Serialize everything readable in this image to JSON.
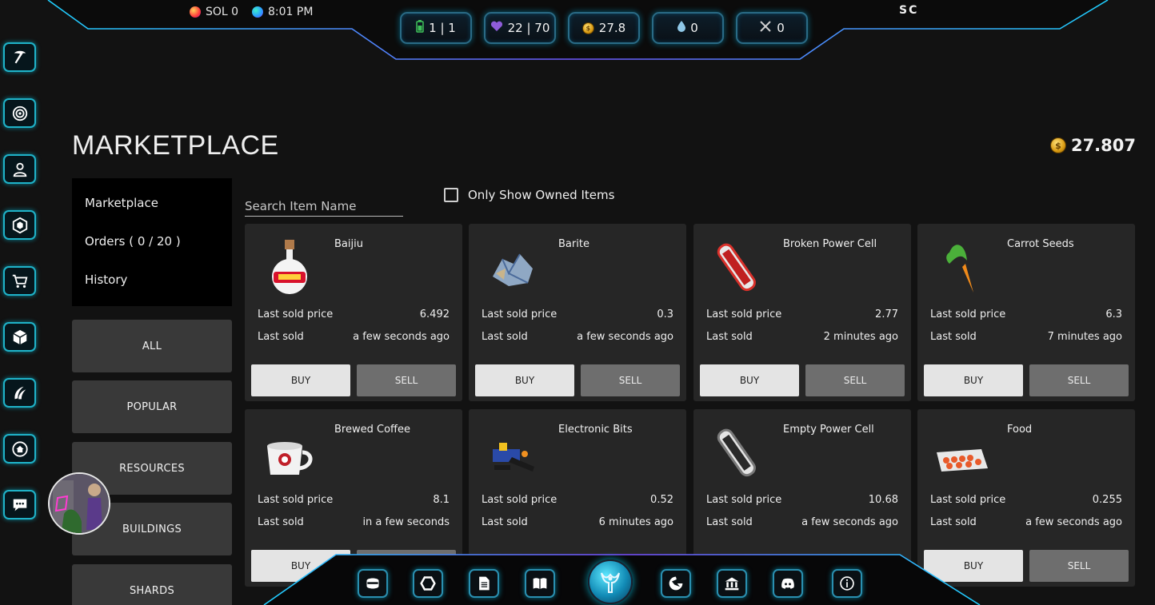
{
  "hud": {
    "sol_label": "SOL 0",
    "time": "8:01 PM",
    "user_initials": "SC",
    "stats": [
      {
        "icon": "battery-icon",
        "value": "1 | 1"
      },
      {
        "icon": "heart-icon",
        "value": "22 | 70"
      },
      {
        "icon": "coin-icon",
        "value": "27.8"
      },
      {
        "icon": "water-drop-icon",
        "value": "0"
      },
      {
        "icon": "crossed-swords-icon",
        "value": "0"
      }
    ]
  },
  "rail": [
    "pickaxe-icon",
    "target-icon",
    "profile-icon",
    "hexagon-network-icon",
    "cart-icon",
    "box-icon",
    "claw-icon",
    "home-icon",
    "chat-icon"
  ],
  "page": {
    "title": "MARKETPLACE",
    "balance": "27.807"
  },
  "sub_nav": [
    "Marketplace",
    "Orders ( 0 / 20 )",
    "History"
  ],
  "categories": [
    "ALL",
    "POPULAR",
    "RESOURCES",
    "BUILDINGS",
    "SHARDS"
  ],
  "search": {
    "placeholder": "Search Item Name"
  },
  "filter": {
    "owned_label": "Only Show Owned Items"
  },
  "labels": {
    "last_sold_price": "Last sold price",
    "last_sold": "Last sold",
    "buy": "BUY",
    "sell": "SELL"
  },
  "items": [
    {
      "name": "Baijiu",
      "price": "6.492",
      "when": "a few seconds ago"
    },
    {
      "name": "Barite",
      "price": "0.3",
      "when": "a few seconds ago"
    },
    {
      "name": "Broken Power Cell",
      "price": "2.77",
      "when": "2 minutes ago"
    },
    {
      "name": "Carrot Seeds",
      "price": "6.3",
      "when": "7 minutes ago"
    },
    {
      "name": "Brewed Coffee",
      "price": "8.1",
      "when": "in a few seconds"
    },
    {
      "name": "Electronic Bits",
      "price": "0.52",
      "when": "6 minutes ago"
    },
    {
      "name": "Empty Power Cell",
      "price": "10.68",
      "when": "a few seconds ago"
    },
    {
      "name": "Food",
      "price": "0.255",
      "when": "a few seconds ago"
    }
  ],
  "dock": [
    "mask-icon",
    "hexagon-icon",
    "document-icon",
    "book-icon",
    "scepter-logo-icon",
    "phoenix-icon",
    "bank-icon",
    "discord-icon",
    "info-icon"
  ],
  "colors": {
    "accent": "#1fb3c9",
    "background": "#121212",
    "card": "#262626",
    "buy": "#e4e4e4",
    "sell": "#6e6e6e"
  }
}
